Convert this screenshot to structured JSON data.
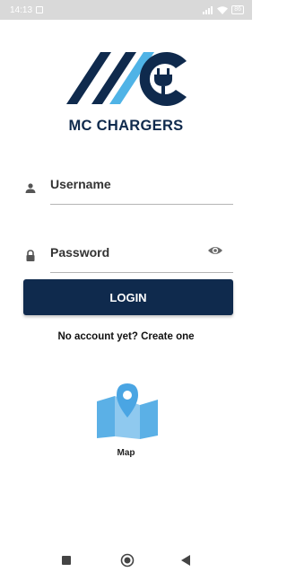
{
  "status_bar": {
    "time": "14:13",
    "battery": "86",
    "icons": [
      "notification-icon",
      "signal-icon",
      "wifi-icon",
      "battery-icon"
    ]
  },
  "brand": {
    "name": "MC CHARGERS",
    "colors": {
      "navy": "#0f2a4d",
      "light_blue": "#4fb3e6"
    }
  },
  "login": {
    "username_label": "Username",
    "password_label": "Password",
    "login_button": "LOGIN",
    "create_account": "No account yet? Create one"
  },
  "map": {
    "label": "Map"
  },
  "nav": {
    "items": [
      "stop-icon",
      "home-icon",
      "back-icon"
    ]
  }
}
